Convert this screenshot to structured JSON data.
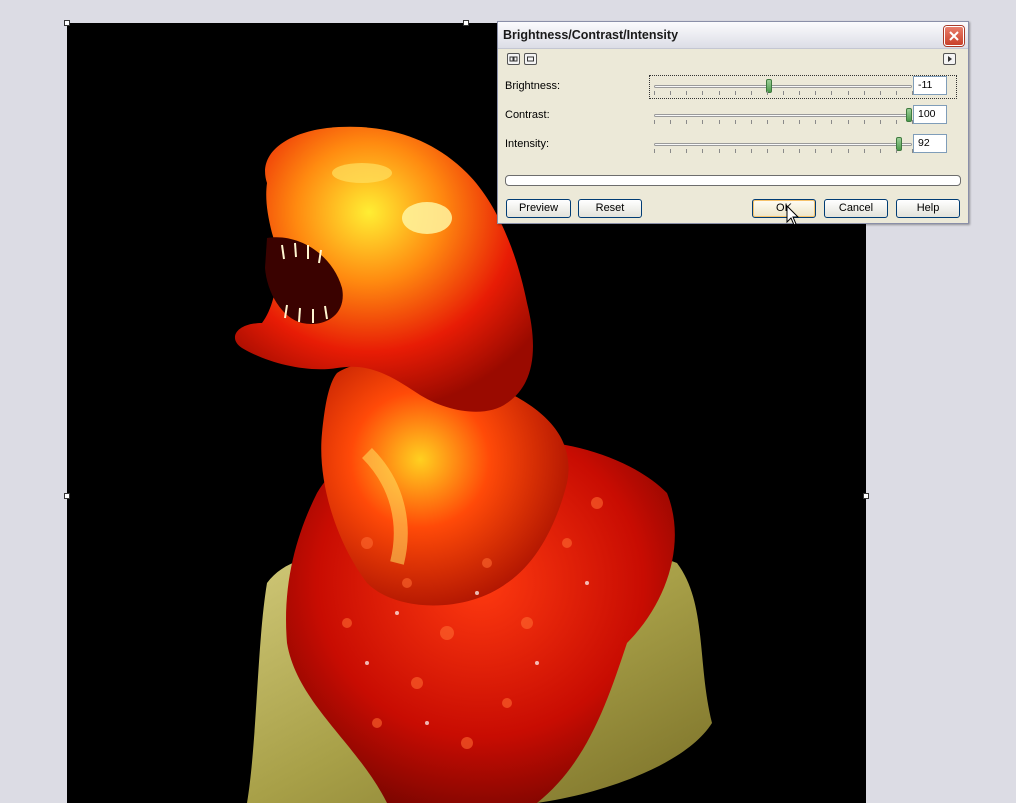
{
  "dialog": {
    "title": "Brightness/Contrast/Intensity",
    "close_icon": "close-icon",
    "toolbar_icons": [
      "expand-icon",
      "collapse-icon",
      "menu-arrow-icon"
    ]
  },
  "sliders": [
    {
      "label": "Brightness:",
      "value": "-11",
      "fraction": 0.445
    },
    {
      "label": "Contrast:",
      "value": "100",
      "fraction": 1.0
    },
    {
      "label": "Intensity:",
      "value": "92",
      "fraction": 0.96
    }
  ],
  "progress": 0,
  "buttons": {
    "preview": "Preview",
    "reset": "Reset",
    "ok": "OK",
    "cancel": "Cancel",
    "help": "Help"
  },
  "colors": {
    "canvas_bg": "#000000",
    "workspace_bg": "#dcdce4",
    "dialog_bg": "#ece9d8",
    "close_button": "#d2533f"
  }
}
